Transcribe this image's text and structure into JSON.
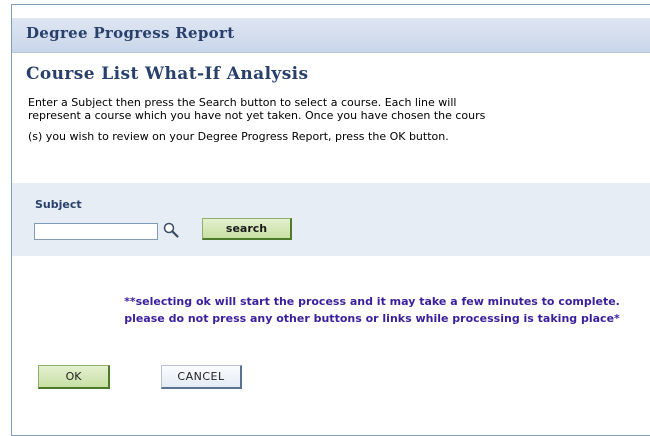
{
  "header": {
    "title": "Degree Progress Report"
  },
  "section": {
    "title": "Course List What-If Analysis",
    "instructions": [
      "Enter a Subject then press the Search button to select a course. Each line will",
      "represent a course which you have not yet taken. Once you have chosen the cours",
      "(s) you wish to review on your Degree Progress Report, press the OK button."
    ]
  },
  "subject_panel": {
    "label": "Subject",
    "input_value": "",
    "lookup_icon": "magnifier-lookup-icon",
    "search_label": "search"
  },
  "warning": {
    "lines": [
      "**selecting ok will start the process and it may take a few minutes to complete.",
      "please do not press any other buttons or links while processing is taking place*"
    ],
    "color": "#3a1f9c"
  },
  "actions": {
    "ok_label": "OK",
    "cancel_label": "CANCEL"
  },
  "colors": {
    "title": "#28406b",
    "header_band": "#c9d6ea",
    "panel": "#e6edf5",
    "primary_button": "#c8e0a4"
  }
}
